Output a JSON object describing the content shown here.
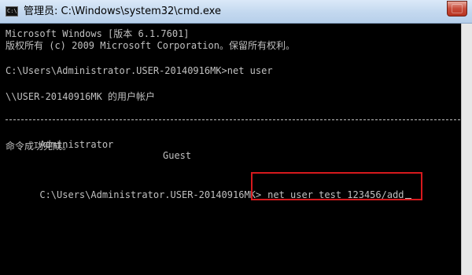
{
  "window": {
    "title": "管理员: C:\\Windows\\system32\\cmd.exe",
    "icon": "cmd-app-icon"
  },
  "console": {
    "lines": [
      "Microsoft Windows [版本 6.1.7601]",
      "版权所有 (c) 2009 Microsoft Corporation。保留所有权利。",
      "C:\\Users\\Administrator.USER-20140916MK>net user",
      "\\\\USER-20140916MK 的用户帐户",
      "命令成功完成。"
    ],
    "user_list": [
      "Administrator",
      "Guest"
    ],
    "prompt": "C:\\Users\\Administrator.USER-20140916MK>",
    "current_input": "net user test 123456/add",
    "highlight_color": "#d7191d"
  }
}
